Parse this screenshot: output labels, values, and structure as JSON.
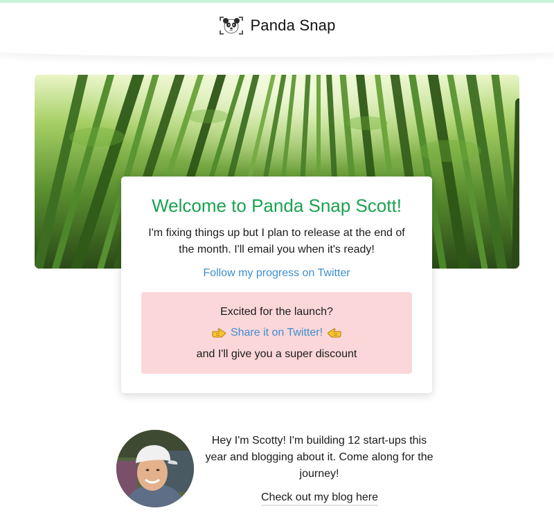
{
  "header": {
    "app_name": "Panda Snap",
    "logo_icon": "panda-face-icon",
    "accent_color": "#c8f2d8"
  },
  "hero": {
    "image": "bamboo-forest"
  },
  "card": {
    "title": "Welcome to Panda Snap Scott!",
    "message": "I'm fixing things up but I plan to release at the end of the month. I'll email you when it's ready!",
    "follow_link": "Follow my progress on Twitter",
    "title_color": "#1aa150",
    "link_color": "#3d8fd1",
    "promo": {
      "question": "Excited for the launch?",
      "share_link": "Share it on Twitter!",
      "left_icon": "pointing-right-hand-icon",
      "right_icon": "pointing-left-hand-icon",
      "discount_text": "and I'll give you a super discount",
      "background": "#fcd7d9"
    }
  },
  "author": {
    "bio": "Hey I'm Scotty! I'm building 12 start-ups this year and blogging about it. Come along for the journey!",
    "blog_link": "Check out my blog here"
  }
}
